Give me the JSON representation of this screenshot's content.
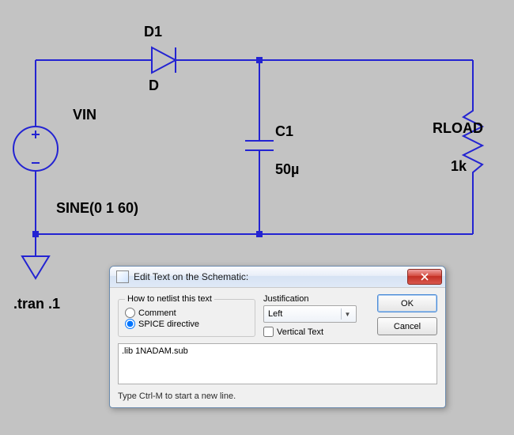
{
  "schematic": {
    "diode": {
      "refdes": "D1",
      "value": "D"
    },
    "vsource": {
      "name": "VIN",
      "spec": "SINE(0 1 60)"
    },
    "cap": {
      "refdes": "C1",
      "value": "50µ"
    },
    "rload": {
      "refdes": "RLOAD",
      "value": "1k"
    },
    "directive_tran": ".tran .1"
  },
  "dialog": {
    "title": "Edit Text on the Schematic:",
    "group_label": "How to netlist this text",
    "opt_comment": "Comment",
    "opt_spice": "SPICE directive",
    "just_label": "Justification",
    "just_value": "Left",
    "vertical_label": "Vertical Text",
    "ok": "OK",
    "cancel": "Cancel",
    "text_value": ".lib 1NADAM.sub",
    "hint": "Type Ctrl-M to start a new line."
  }
}
